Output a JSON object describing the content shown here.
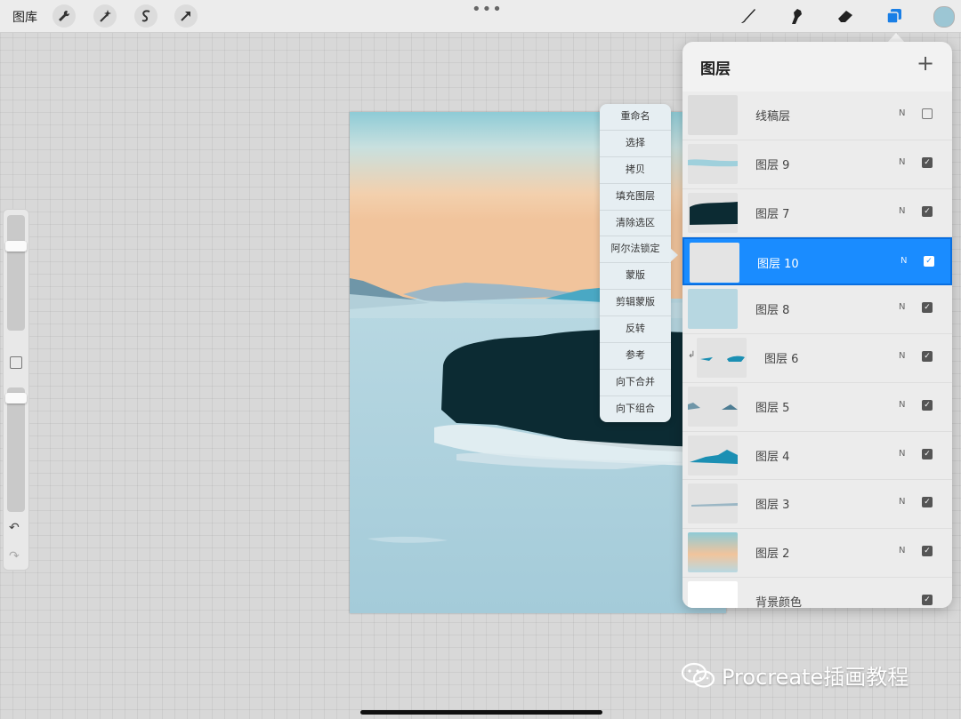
{
  "toolbar": {
    "gallery_label": "图库",
    "left_icons": [
      "wrench-icon",
      "magic-wand-icon",
      "selection-s-icon",
      "arrow-cursor-icon"
    ],
    "more_glyph": "•••",
    "right_icons": [
      "brush-icon",
      "smudge-icon",
      "eraser-icon",
      "layers-icon"
    ],
    "current_color": "#9cc6d4",
    "layers_icon_color": "#1a7fe6"
  },
  "context_menu": {
    "items": [
      "重命名",
      "选择",
      "拷贝",
      "填充图层",
      "清除选区",
      "阿尔法锁定",
      "蒙版",
      "剪辑蒙版",
      "反转",
      "参考",
      "向下合并",
      "向下组合"
    ]
  },
  "layers_panel": {
    "title": "图层",
    "add_glyph": "+",
    "selected_color": "#1a8cff",
    "layers": [
      {
        "name": "线稿层",
        "blend": "N",
        "visible": false,
        "selected": false,
        "clipped": false
      },
      {
        "name": "图层 9",
        "blend": "N",
        "visible": true,
        "selected": false,
        "clipped": false
      },
      {
        "name": "图层 7",
        "blend": "N",
        "visible": true,
        "selected": false,
        "clipped": false
      },
      {
        "name": "图层 10",
        "blend": "N",
        "visible": true,
        "selected": true,
        "clipped": false
      },
      {
        "name": "图层 8",
        "blend": "N",
        "visible": true,
        "selected": false,
        "clipped": false
      },
      {
        "name": "图层 6",
        "blend": "N",
        "visible": true,
        "selected": false,
        "clipped": true
      },
      {
        "name": "图层 5",
        "blend": "N",
        "visible": true,
        "selected": false,
        "clipped": false
      },
      {
        "name": "图层 4",
        "blend": "N",
        "visible": true,
        "selected": false,
        "clipped": false
      },
      {
        "name": "图层 3",
        "blend": "N",
        "visible": true,
        "selected": false,
        "clipped": false
      },
      {
        "name": "图层 2",
        "blend": "N",
        "visible": true,
        "selected": false,
        "clipped": false
      },
      {
        "name": "背景颜色",
        "blend": "",
        "visible": true,
        "selected": false,
        "clipped": false
      }
    ]
  },
  "watermark": {
    "text": "Procreate插画教程",
    "icon": "wechat-icon"
  }
}
